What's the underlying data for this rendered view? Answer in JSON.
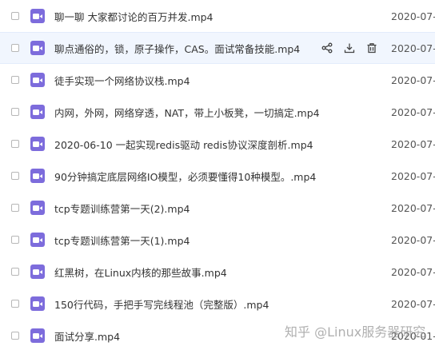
{
  "files": [
    {
      "name": "聊一聊 大家都讨论的百万并发.mp4",
      "date": "2020-07-"
    },
    {
      "name": "聊点通俗的，锁，原子操作，CAS。面试常备技能.mp4",
      "date": "2020-07-"
    },
    {
      "name": "徒手实现一个网络协议栈.mp4",
      "date": "2020-07-"
    },
    {
      "name": "内网，外网，网络穿透，NAT，带上小板凳，一切搞定.mp4",
      "date": "2020-07-"
    },
    {
      "name": "2020-06-10 一起实现redis驱动 redis协议深度剖析.mp4",
      "date": "2020-07-"
    },
    {
      "name": "90分钟搞定底层网络IO模型，必须要懂得10种模型。.mp4",
      "date": "2020-07-"
    },
    {
      "name": "tcp专题训练营第一天(2).mp4",
      "date": "2020-07-"
    },
    {
      "name": "tcp专题训练营第一天(1).mp4",
      "date": "2020-07-"
    },
    {
      "name": "红黑树，在Linux内核的那些故事.mp4",
      "date": "2020-07-"
    },
    {
      "name": "150行代码，手把手写完线程池（完整版）.mp4",
      "date": "2020-07-"
    },
    {
      "name": "面试分享.mp4",
      "date": "2020-01-"
    }
  ],
  "hovered_row_index": 1,
  "row_actions": [
    "share-icon",
    "download-icon",
    "delete-icon"
  ],
  "file_icon": "video-file-icon",
  "watermark": "知乎 @Linux服务器研究",
  "colors": {
    "icon_bg": "#7d6cdc",
    "hover_bg": "#f1f6fe",
    "text": "#333333",
    "date_text": "#555555"
  }
}
